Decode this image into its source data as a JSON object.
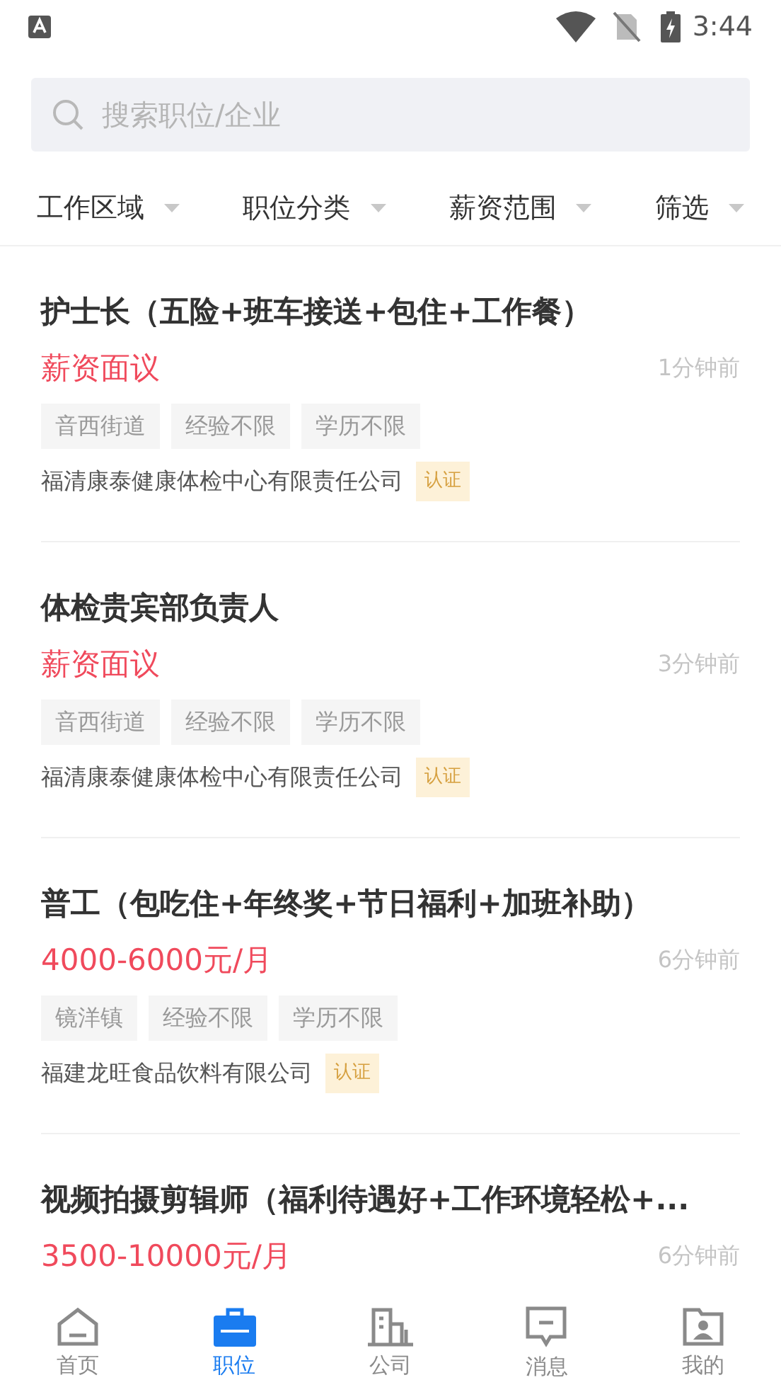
{
  "status_bar": {
    "time": "3:44"
  },
  "search": {
    "placeholder": "搜索职位/企业"
  },
  "filters": [
    {
      "label": "工作区域"
    },
    {
      "label": "职位分类"
    },
    {
      "label": "薪资范围"
    },
    {
      "label": "筛选"
    }
  ],
  "jobs": [
    {
      "title": "护士长（五险+班车接送+包住+工作餐）",
      "salary": "薪资面议",
      "time": "1分钟前",
      "tags": [
        "音西街道",
        "经验不限",
        "学历不限"
      ],
      "company": "福清康泰健康体检中心有限责任公司",
      "badge": "认证"
    },
    {
      "title": "体检贵宾部负责人",
      "salary": "薪资面议",
      "time": "3分钟前",
      "tags": [
        "音西街道",
        "经验不限",
        "学历不限"
      ],
      "company": "福清康泰健康体检中心有限责任公司",
      "badge": "认证"
    },
    {
      "title": "普工（包吃住+年终奖+节日福利+加班补助）",
      "salary": "4000-6000元/月",
      "time": "6分钟前",
      "tags": [
        "镜洋镇",
        "经验不限",
        "学历不限"
      ],
      "company": "福建龙旺食品饮料有限公司",
      "badge": "认证"
    },
    {
      "title": "视频拍摄剪辑师（福利待遇好+工作环境轻松+...",
      "salary": "3500-10000元/月",
      "time": "6分钟前"
    }
  ],
  "nav": [
    {
      "kind": "home",
      "label": "首页",
      "selected": false
    },
    {
      "kind": "jobs",
      "label": "职位",
      "selected": true
    },
    {
      "kind": "company",
      "label": "公司",
      "selected": false
    },
    {
      "kind": "message",
      "label": "消息",
      "selected": false
    },
    {
      "kind": "me",
      "label": "我的",
      "selected": false
    }
  ]
}
